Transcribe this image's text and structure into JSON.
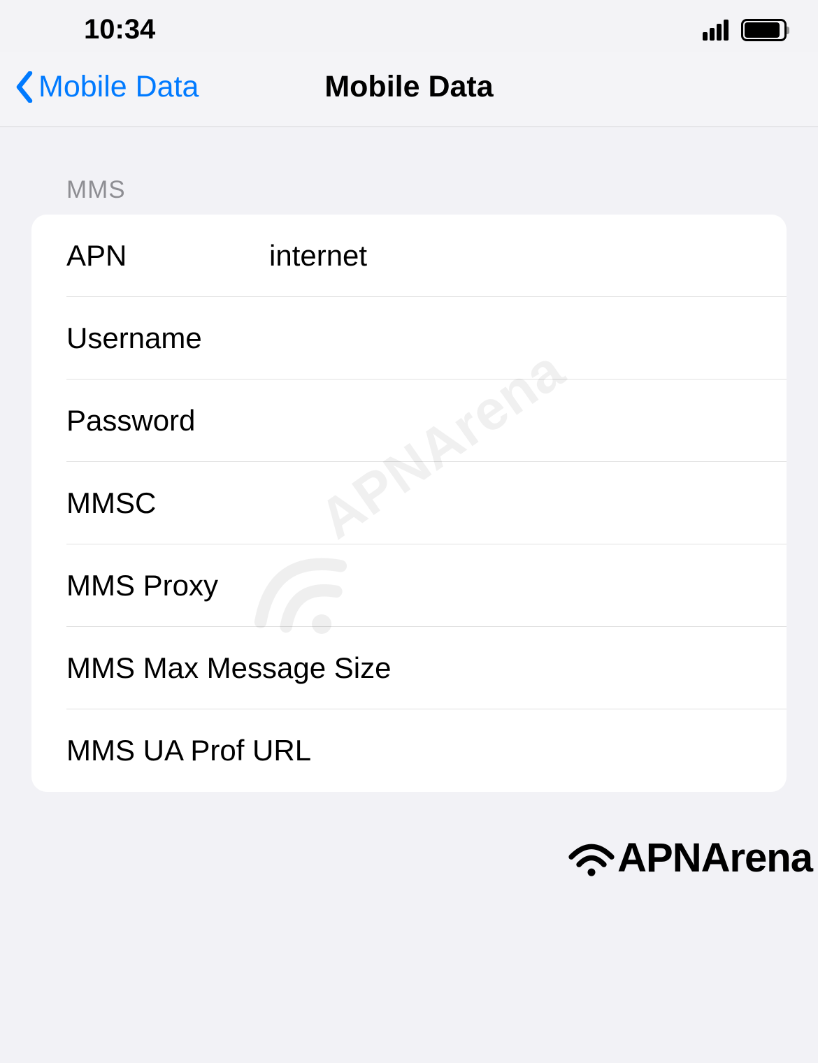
{
  "status_bar": {
    "time": "10:34"
  },
  "nav": {
    "back_label": "Mobile Data",
    "title": "Mobile Data"
  },
  "section": {
    "header": "MMS",
    "rows": [
      {
        "label": "APN",
        "value": "internet"
      },
      {
        "label": "Username",
        "value": ""
      },
      {
        "label": "Password",
        "value": ""
      },
      {
        "label": "MMSC",
        "value": ""
      },
      {
        "label": "MMS Proxy",
        "value": ""
      },
      {
        "label": "MMS Max Message Size",
        "value": ""
      },
      {
        "label": "MMS UA Prof URL",
        "value": ""
      }
    ]
  },
  "watermark": {
    "text": "APNArena",
    "footer_text": "APNArena"
  }
}
